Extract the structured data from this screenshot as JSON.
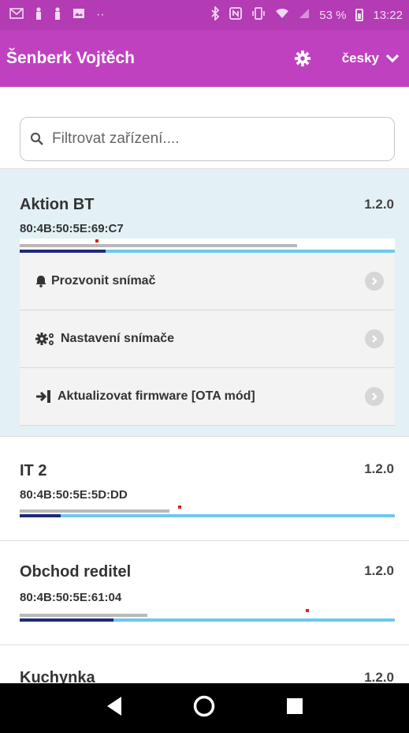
{
  "status_bar": {
    "battery": "53 %",
    "time": "13:22",
    "icons": [
      "gmail-icon",
      "person-icon",
      "person-icon",
      "image-icon",
      "dots-icon",
      "bluetooth-icon",
      "nfc-icon",
      "vibrate-icon",
      "wifi-icon",
      "signal-icon",
      "battery-icon"
    ]
  },
  "app_bar": {
    "title": "Šenberk Vojtěch",
    "language": "česky",
    "background": "#c041c0",
    "status_background": "#b33bb3"
  },
  "search": {
    "placeholder": "Filtrovat zařízení...."
  },
  "devices": [
    {
      "name": "Aktion BT",
      "version": "1.2.0",
      "mac": "80:4B:50:5E:69:C7",
      "expanded": true,
      "actions": [
        {
          "icon": "bell-icon",
          "label": "Prozvonit snímač"
        },
        {
          "icon": "gears-icon",
          "label": "Nastavení snímače"
        },
        {
          "icon": "sign-in-icon",
          "label": "Aktualizovat firmware [OTA mód]"
        }
      ],
      "bar": {
        "navy_fraction": 0.23,
        "gray_fraction": 0.74
      }
    },
    {
      "name": "IT 2",
      "version": "1.2.0",
      "mac": "80:4B:50:5E:5D:DD",
      "expanded": false,
      "bar": {
        "navy_fraction": 0.11,
        "gray_fraction": 0.4
      }
    },
    {
      "name": "Obchod reditel",
      "version": "1.2.0",
      "mac": "80:4B:50:5E:61:04",
      "expanded": false,
      "bar": {
        "navy_fraction": 0.25,
        "gray_fraction": 0.34
      }
    },
    {
      "name": "Kuchynka",
      "version": "1.2.0"
    }
  ],
  "nav": [
    "back-icon",
    "home-icon",
    "recents-icon"
  ]
}
